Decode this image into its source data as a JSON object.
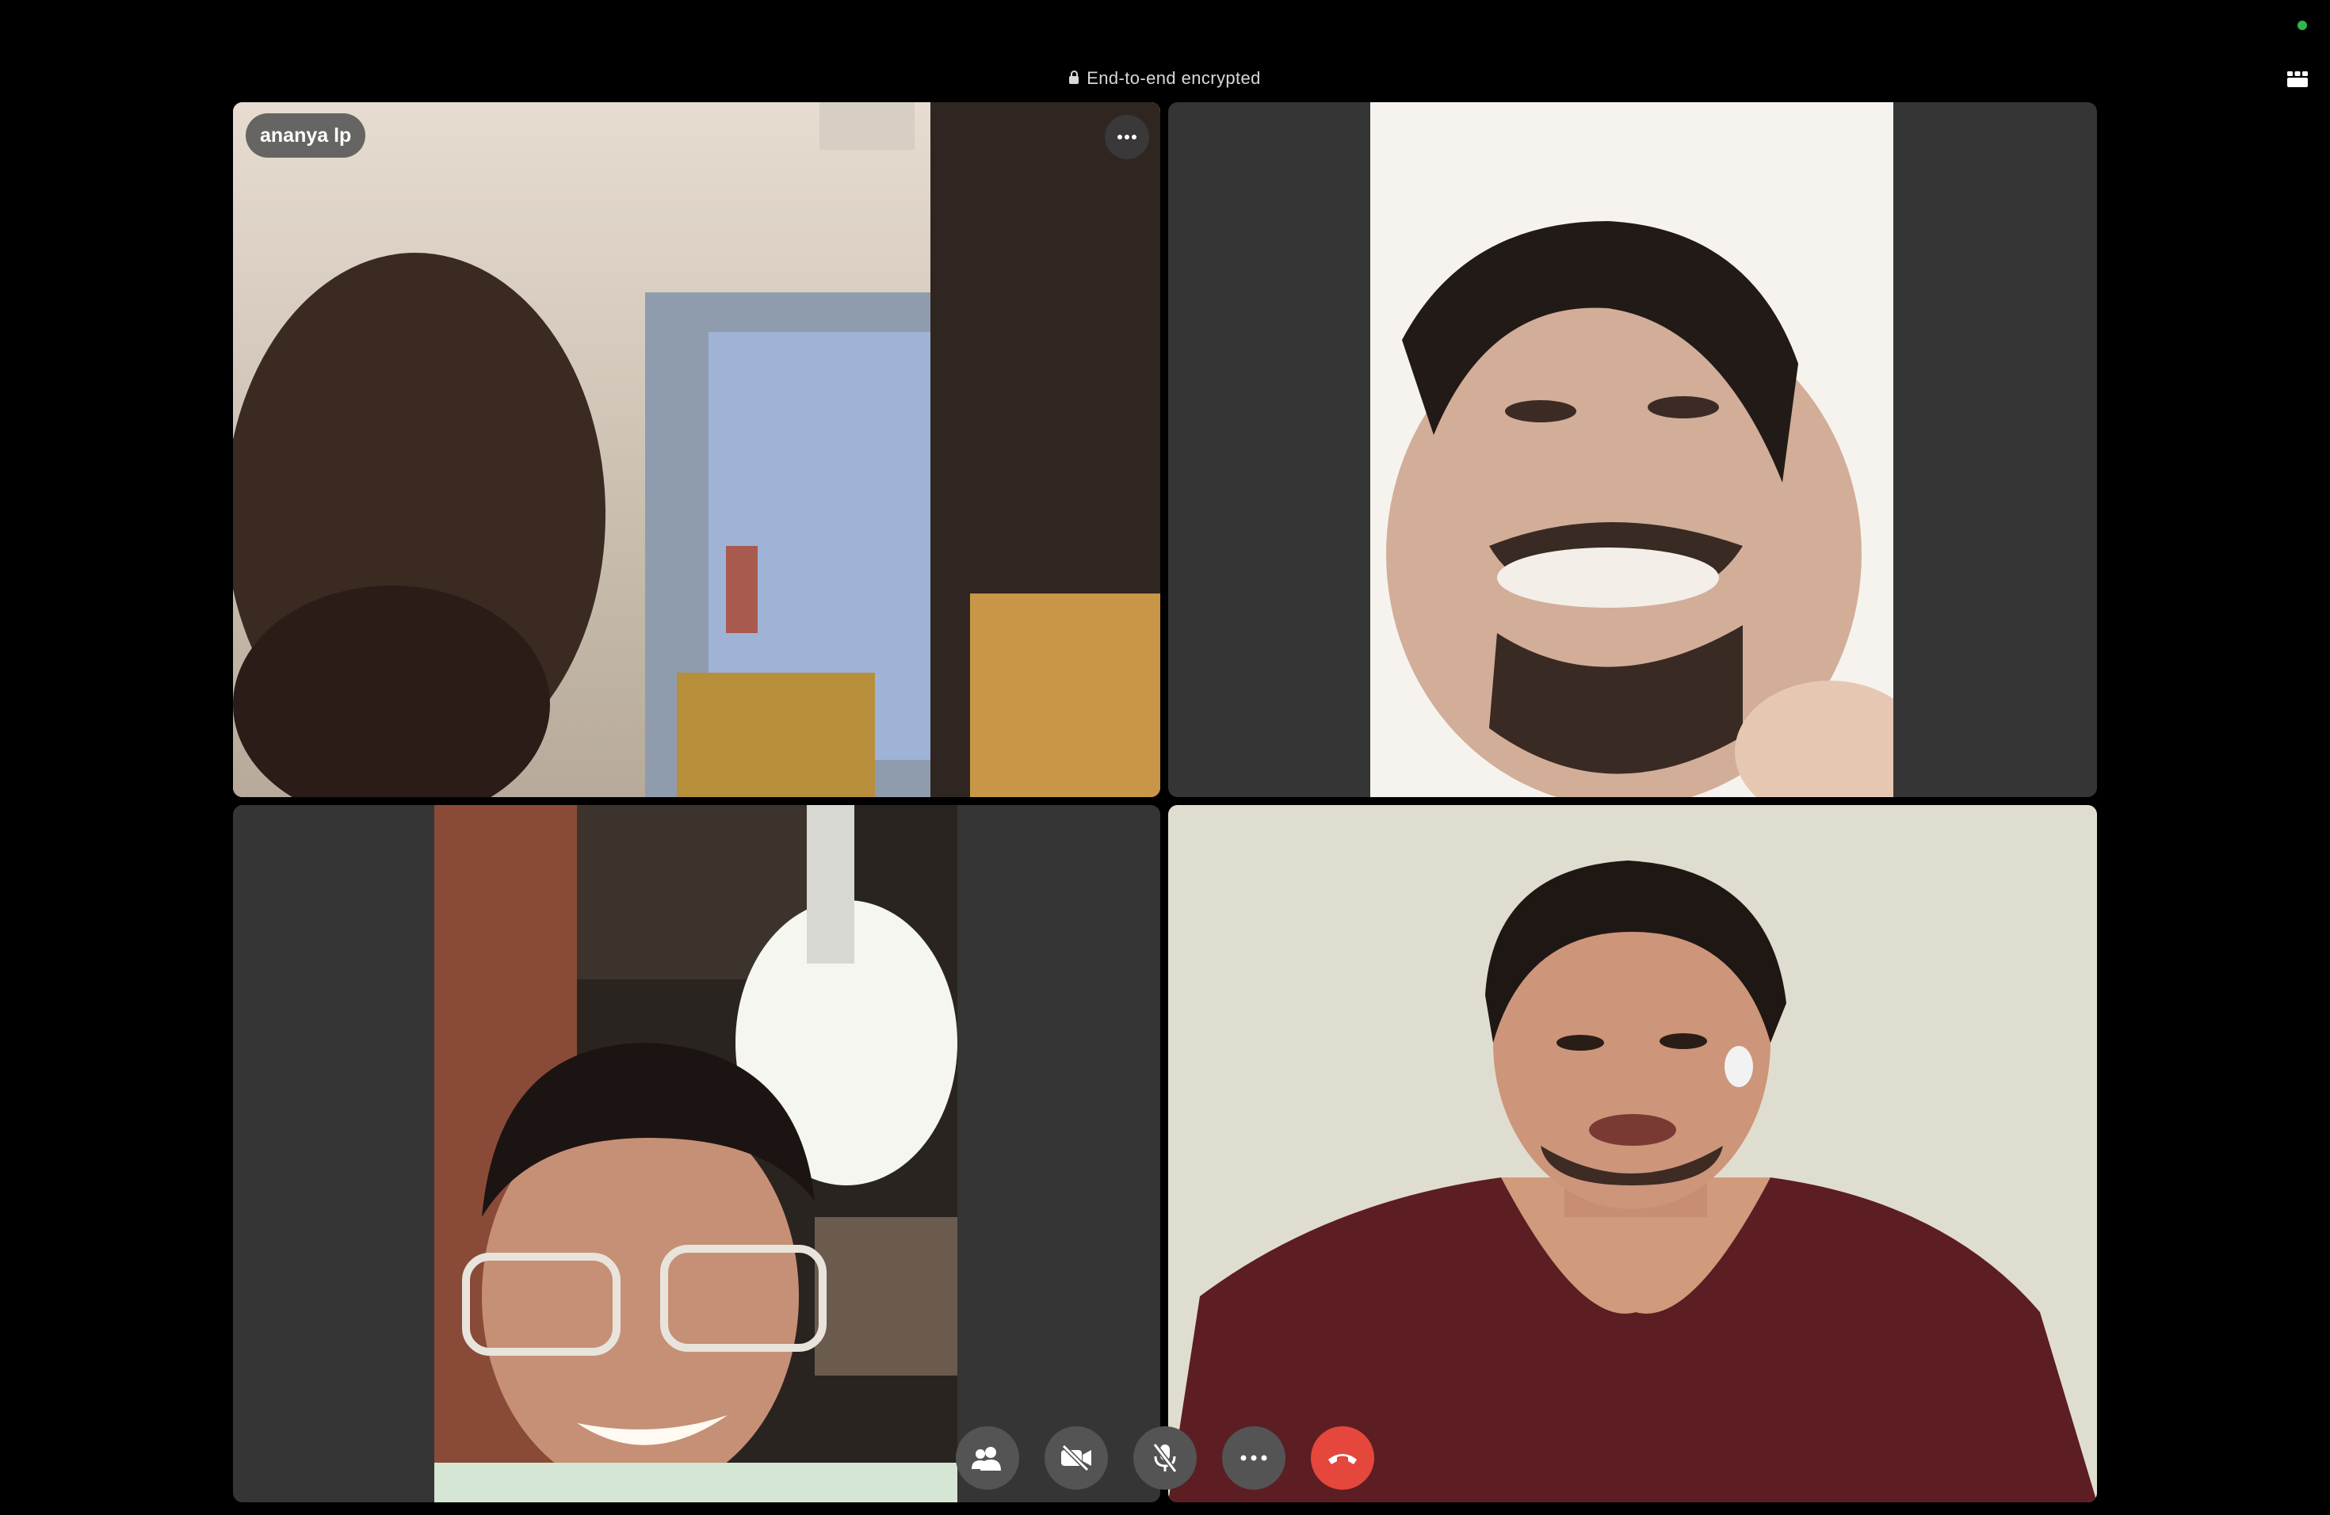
{
  "header": {
    "encryption_label": "End-to-end encrypted"
  },
  "participants": [
    {
      "name": "ananya lp",
      "active_speaker": true
    },
    {
      "name": ""
    },
    {
      "name": ""
    },
    {
      "name": ""
    }
  ],
  "controls": [
    {
      "icon": "people-icon"
    },
    {
      "icon": "camera-off-icon"
    },
    {
      "icon": "mic-muted-icon"
    },
    {
      "icon": "more-icon"
    },
    {
      "icon": "end-call-icon"
    }
  ],
  "colors": {
    "background": "#000000",
    "tile": "#353535",
    "control_button": "#545454",
    "end_call": "#e5473c",
    "status_online": "#2fb84a"
  }
}
